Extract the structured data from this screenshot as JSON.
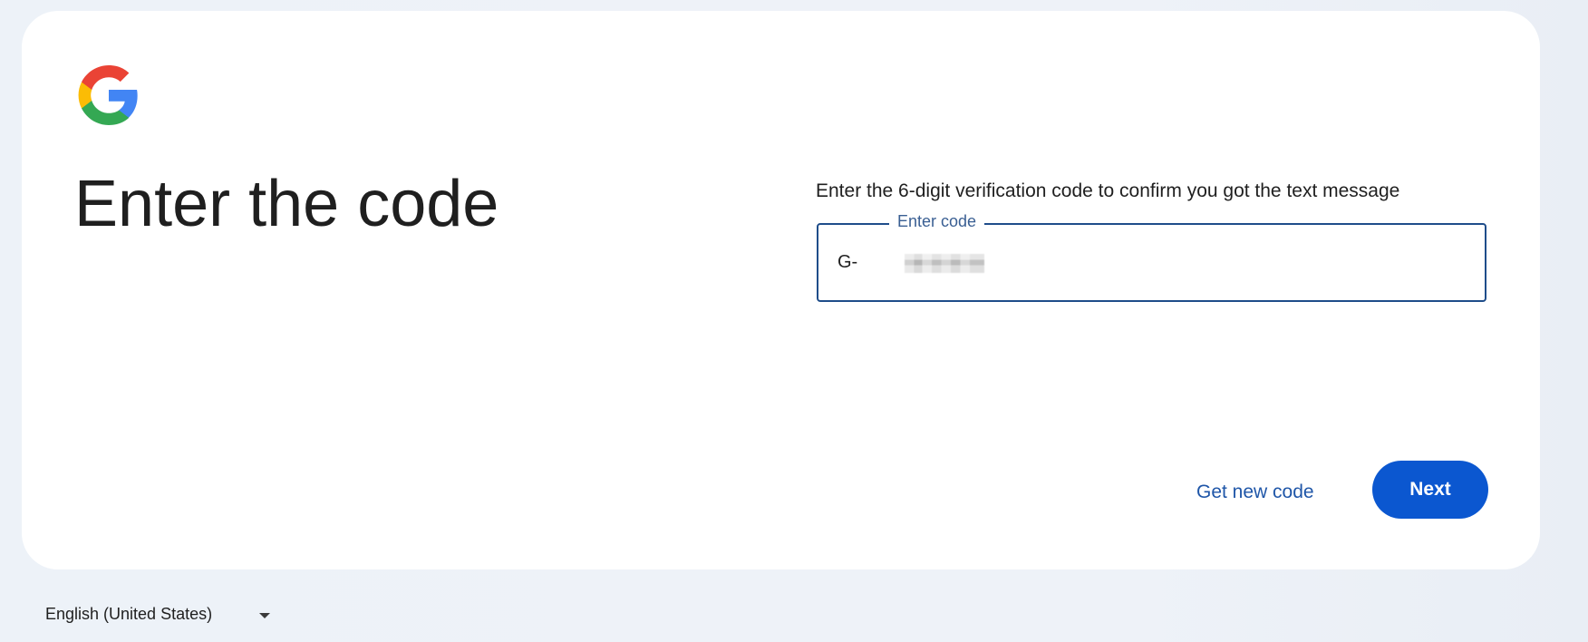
{
  "brand": {
    "logo_icon": "google-g-icon",
    "colors": {
      "blue": "#4285F4",
      "red": "#EA4335",
      "yellow": "#FBBC05",
      "green": "#34A853",
      "primary_button": "#0B57D0"
    }
  },
  "page": {
    "title": "Enter the code",
    "instructions": "Enter the 6-digit verification code to confirm you got the text message"
  },
  "code_field": {
    "label": "Enter code",
    "prefix": "G-",
    "value": ""
  },
  "actions": {
    "secondary_label": "Get new code",
    "primary_label": "Next"
  },
  "footer": {
    "language": "English (United States)",
    "language_arrow_icon": "caret-down-icon"
  }
}
